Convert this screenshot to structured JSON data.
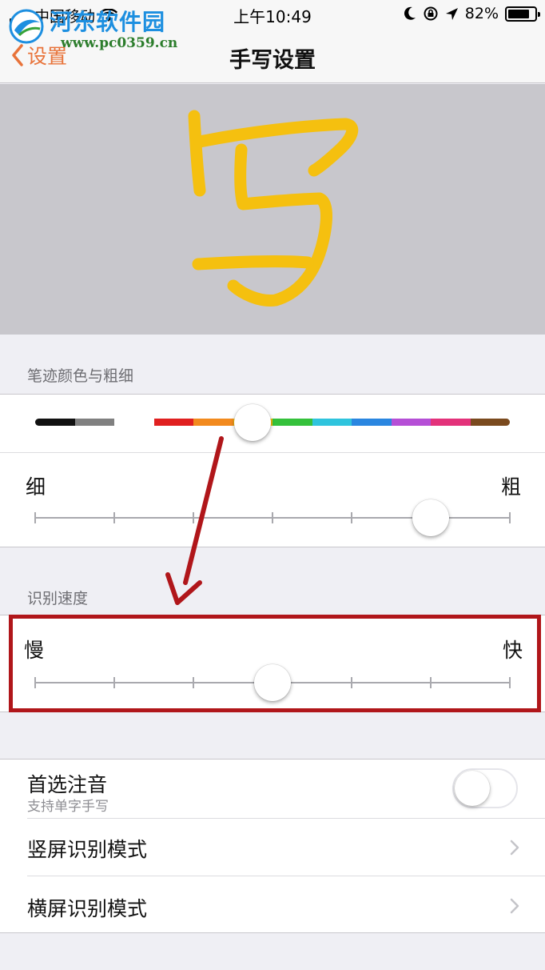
{
  "status_bar": {
    "carrier": "中国移动",
    "time": "上午10:49",
    "battery_percent": "82%",
    "battery_level": 0.82,
    "icons": [
      "signal-icon",
      "wifi-icon",
      "moon-icon",
      "rotation-lock-icon",
      "location-arrow-icon",
      "battery-icon"
    ]
  },
  "nav": {
    "back_label": "设置",
    "title": "手写设置"
  },
  "watermark": {
    "site_name": "河东软件园",
    "url": "www.pc0359.cn"
  },
  "canvas": {
    "handwritten_char": "写",
    "stroke_color": "#f5c00f"
  },
  "pen_section": {
    "header": "笔迹颜色与粗细",
    "palette": [
      "#111111",
      "#808080",
      "#ffffff",
      "#e02020",
      "#f28a1e",
      "#f5c00f",
      "#35c13b",
      "#2fc4dd",
      "#2a86e0",
      "#b54fd6",
      "#e3327a",
      "#7a4a1e"
    ],
    "selected_color_index": 5,
    "thickness_min_label": "细",
    "thickness_max_label": "粗",
    "thickness_steps": 7,
    "thickness_value": 6
  },
  "speed_section": {
    "header": "识别速度",
    "min_label": "慢",
    "max_label": "快",
    "steps": 7,
    "value": 4
  },
  "options": {
    "preferred_zhuyin_title": "首选注音",
    "preferred_zhuyin_subtitle": "支持单字手写",
    "preferred_zhuyin_on": false,
    "portrait_mode_label": "竖屏识别模式",
    "landscape_mode_label": "横屏识别模式"
  },
  "annotation": {
    "arrow_color": "#b0161a",
    "box_color": "#b0161a"
  }
}
